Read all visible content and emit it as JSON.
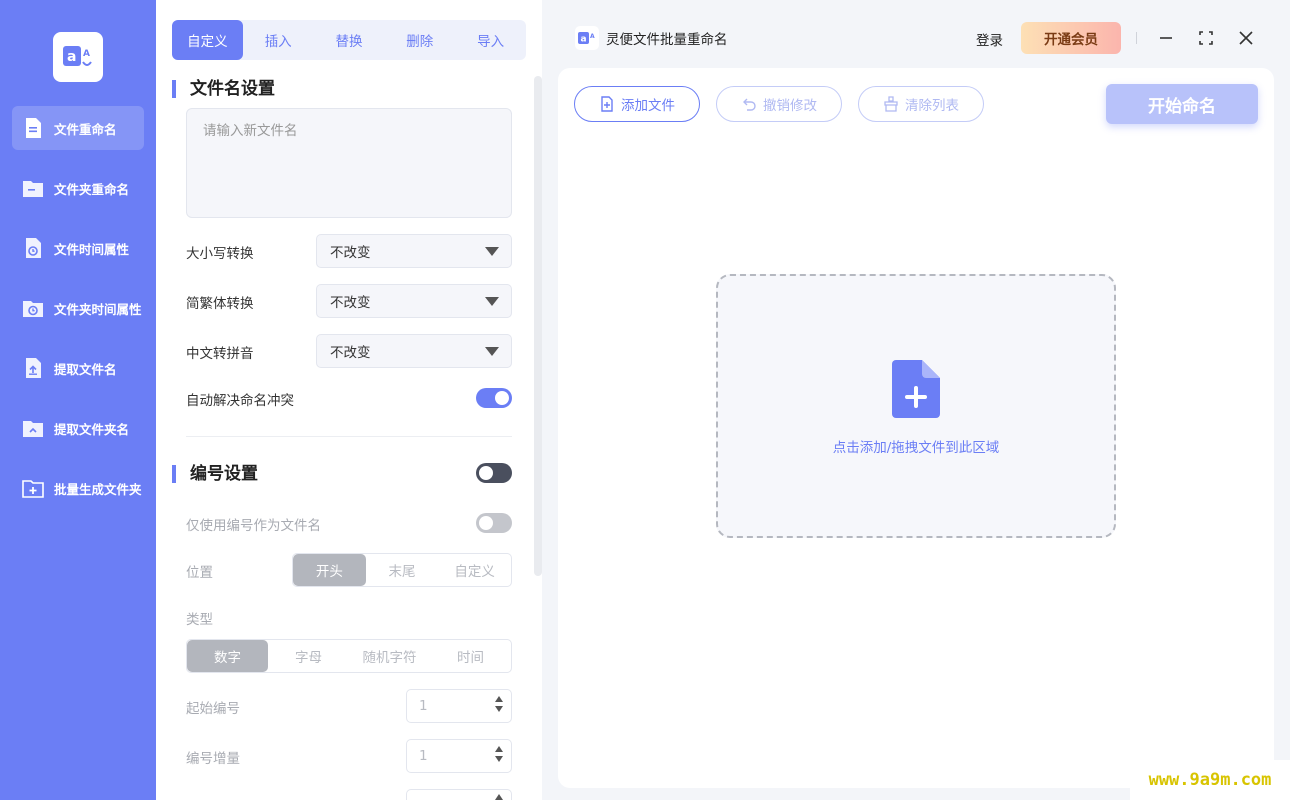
{
  "sidebar": {
    "items": [
      {
        "label": "文件重命名",
        "icon": "file-doc-icon"
      },
      {
        "label": "文件夹重命名",
        "icon": "folder-icon"
      },
      {
        "label": "文件时间属性",
        "icon": "file-clock-icon"
      },
      {
        "label": "文件夹时间属性",
        "icon": "folder-clock-icon"
      },
      {
        "label": "提取文件名",
        "icon": "file-upload-icon"
      },
      {
        "label": "提取文件夹名",
        "icon": "folder-up-icon"
      },
      {
        "label": "批量生成文件夹",
        "icon": "folder-add-icon"
      }
    ]
  },
  "tabs": [
    "自定义",
    "插入",
    "替换",
    "删除",
    "导入"
  ],
  "filename_settings": {
    "title": "文件名设置",
    "input_placeholder": "请输入新文件名",
    "case_label": "大小写转换",
    "case_value": "不改变",
    "trad_label": "简繁体转换",
    "trad_value": "不改变",
    "pinyin_label": "中文转拼音",
    "pinyin_value": "不改变",
    "conflict_label": "自动解决命名冲突"
  },
  "numbering": {
    "title": "编号设置",
    "only_number_label": "仅使用编号作为文件名",
    "position_label": "位置",
    "positions": [
      "开头",
      "末尾",
      "自定义"
    ],
    "type_label": "类型",
    "types": [
      "数字",
      "字母",
      "随机字符",
      "时间"
    ],
    "start_label": "起始编号",
    "start_value": "1",
    "step_label": "编号增量",
    "step_value": "1"
  },
  "titlebar": {
    "app_title": "灵便文件批量重命名",
    "login": "登录",
    "vip": "开通会员"
  },
  "toolbar": {
    "add_file": "添加文件",
    "undo": "撤销修改",
    "clear": "清除列表",
    "start": "开始命名"
  },
  "dropzone": {
    "text": "点击添加/拖拽文件到此区域"
  },
  "watermark": "www.9a9m.com",
  "colors": {
    "accent": "#6b7ef5",
    "vip_gradient_start": "#fde0b5",
    "vip_gradient_end": "#fbb5ad"
  }
}
